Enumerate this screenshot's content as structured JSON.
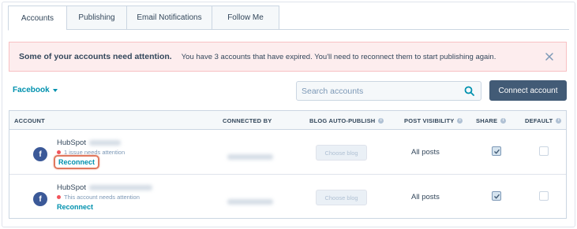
{
  "tabs": [
    {
      "label": "Accounts",
      "active": true
    },
    {
      "label": "Publishing",
      "active": false
    },
    {
      "label": "Email Notifications",
      "active": false
    },
    {
      "label": "Follow Me",
      "active": false
    }
  ],
  "alert": {
    "title": "Some of your accounts need attention.",
    "message": "You have 3 accounts that have expired. You'll need to reconnect them to start publishing again.",
    "close_icon": "close-icon"
  },
  "network_filter": {
    "label": "Facebook"
  },
  "search": {
    "placeholder": "Search accounts",
    "value": ""
  },
  "connect_button": {
    "label": "Connect account"
  },
  "table": {
    "headers": {
      "account": "ACCOUNT",
      "connected_by": "CONNECTED BY",
      "blog_auto_publish": "BLOG AUTO-PUBLISH",
      "post_visibility": "POST VISIBILITY",
      "share": "SHARE",
      "default": "DEFAULT"
    },
    "rows": [
      {
        "icon": "facebook-icon",
        "name": "HubSpot",
        "status": "1 issue needs attention",
        "action": "Reconnect",
        "blog": "Choose blog",
        "visibility": "All posts",
        "share": true,
        "default": false
      },
      {
        "icon": "facebook-icon",
        "name": "HubSpot",
        "status": "This account needs attention",
        "action": "Reconnect",
        "blog": "Choose blog",
        "visibility": "All posts",
        "share": true,
        "default": false
      }
    ]
  },
  "colors": {
    "accent": "#0091ae",
    "primary_button": "#425b76",
    "alert_bg": "#fdedee",
    "status_dot": "#f2545b",
    "facebook": "#3b5998",
    "highlight": "#e0785e"
  }
}
